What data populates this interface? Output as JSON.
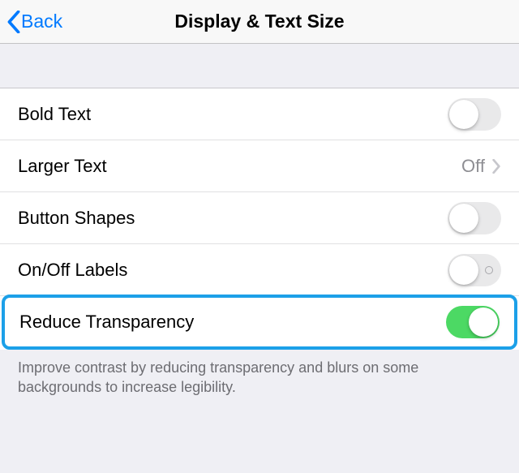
{
  "nav": {
    "back_label": "Back",
    "title": "Display & Text Size"
  },
  "rows": {
    "bold_text": {
      "label": "Bold Text",
      "on": false
    },
    "larger_text": {
      "label": "Larger Text",
      "value": "Off"
    },
    "button_shapes": {
      "label": "Button Shapes",
      "on": false
    },
    "onoff_labels": {
      "label": "On/Off Labels",
      "on": false
    },
    "reduce_transparency": {
      "label": "Reduce Transparency",
      "on": true
    }
  },
  "footer": "Improve contrast by reducing transparency and blurs on some backgrounds to increase legibility."
}
